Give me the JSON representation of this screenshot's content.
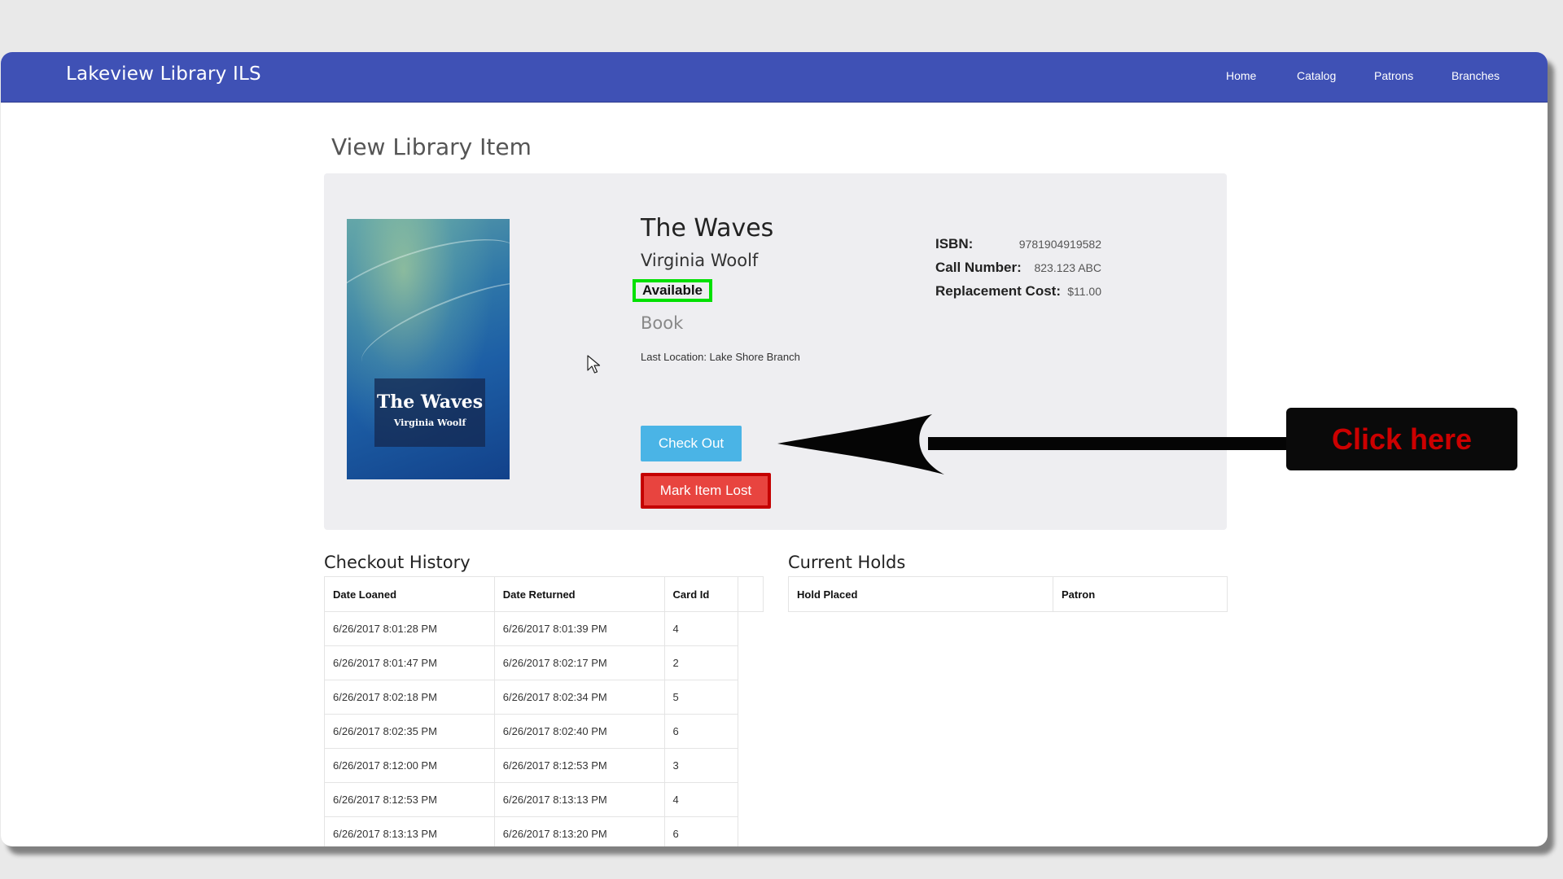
{
  "app": {
    "brand": "Lakeview Library ILS"
  },
  "nav": {
    "items": [
      {
        "label": "Home"
      },
      {
        "label": "Catalog"
      },
      {
        "label": "Patrons"
      },
      {
        "label": "Branches"
      }
    ]
  },
  "page": {
    "title": "View Library Item"
  },
  "item": {
    "cover": {
      "title": "The Waves",
      "author": "Virginia Woolf"
    },
    "title": "The Waves",
    "author": "Virginia Woolf",
    "status": "Available",
    "type": "Book",
    "last_location": "Last Location: Lake Shore Branch",
    "isbn_label": "ISBN:",
    "isbn": "9781904919582",
    "call_number_label": "Call Number:",
    "call_number": "823.123 ABC",
    "replacement_cost_label": "Replacement Cost:",
    "replacement_cost": "$11.00"
  },
  "actions": {
    "checkout_label": "Check Out",
    "mark_lost_label": "Mark Item Lost"
  },
  "history": {
    "heading": "Checkout History",
    "columns": [
      "Date Loaned",
      "Date Returned",
      "Card Id"
    ],
    "rows": [
      [
        "6/26/2017 8:01:28 PM",
        "6/26/2017 8:01:39 PM",
        "4"
      ],
      [
        "6/26/2017 8:01:47 PM",
        "6/26/2017 8:02:17 PM",
        "2"
      ],
      [
        "6/26/2017 8:02:18 PM",
        "6/26/2017 8:02:34 PM",
        "5"
      ],
      [
        "6/26/2017 8:02:35 PM",
        "6/26/2017 8:02:40 PM",
        "6"
      ],
      [
        "6/26/2017 8:12:00 PM",
        "6/26/2017 8:12:53 PM",
        "3"
      ],
      [
        "6/26/2017 8:12:53 PM",
        "6/26/2017 8:13:13 PM",
        "4"
      ],
      [
        "6/26/2017 8:13:13 PM",
        "6/26/2017 8:13:20 PM",
        "6"
      ]
    ]
  },
  "holds": {
    "heading": "Current Holds",
    "columns": [
      "Hold Placed",
      "Patron"
    ]
  },
  "annotation": {
    "text": "Click here"
  },
  "colors": {
    "navbar": "#3f51b5",
    "status_outline": "#00e000",
    "lost_button": "#e8443f",
    "checkout_button": "#4ab4e6",
    "annotation_text": "#cc0000"
  }
}
